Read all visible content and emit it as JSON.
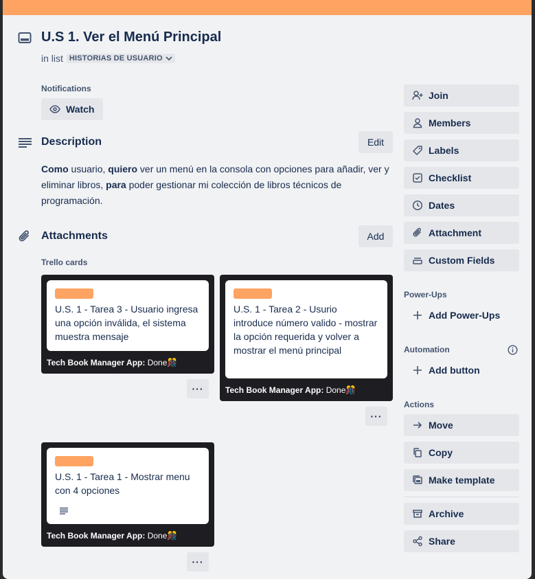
{
  "card": {
    "title": "U.S 1. Ver el Menú Principal",
    "in_list_prefix": "in list",
    "list_name": "HISTORIAS DE USUARIO"
  },
  "notifications": {
    "label": "Notifications",
    "watch_label": "Watch"
  },
  "description": {
    "heading": "Description",
    "edit_label": "Edit",
    "parts": {
      "w1": "Como",
      "t1": " usuario, ",
      "w2": "quiero",
      "t2": " ver un menú en la consola con opciones para añadir, ver y eliminar libros, ",
      "w3": "para",
      "t3": " poder gestionar mi colección de libros técnicos de programación."
    }
  },
  "attachments": {
    "heading": "Attachments",
    "add_label": "Add",
    "group_label": "Trello cards",
    "cards": [
      {
        "text": "U.S. 1 - Tarea 3 - Usuario ingresa una opción inválida, el sistema muestra mensaje",
        "board": "Tech Book Manager App:",
        "list": "Done",
        "emoji": "🎊",
        "more": "···"
      },
      {
        "text": "U.S. 1 - Tarea 2 - Usurio introduce número valido - mostrar la opción requerida y volver a mostrar el menú principal",
        "board": "Tech Book Manager App:",
        "list": "Done",
        "emoji": "🎊",
        "more": "···"
      },
      {
        "text": "U.S. 1 - Tarea 1 - Mostrar menu con 4 opciones",
        "board": "Tech Book Manager App:",
        "list": "Done",
        "emoji": "🎊",
        "more": "···"
      }
    ]
  },
  "sidebar": {
    "add_to_card": [
      "Join",
      "Members",
      "Labels",
      "Checklist",
      "Dates",
      "Attachment",
      "Custom Fields"
    ],
    "powerups_label": "Power-Ups",
    "add_powerups": "Add Power-Ups",
    "automation_label": "Automation",
    "add_button": "Add button",
    "actions_label": "Actions",
    "actions": [
      "Move",
      "Copy",
      "Make template",
      "Archive",
      "Share"
    ]
  },
  "colors": {
    "cover": "#fea362",
    "label_bar": "#fea362",
    "panel": "#f1f2f4",
    "button": "#e4e6ea",
    "text": "#172b4d",
    "attachment_bg": "#1d1d22"
  }
}
